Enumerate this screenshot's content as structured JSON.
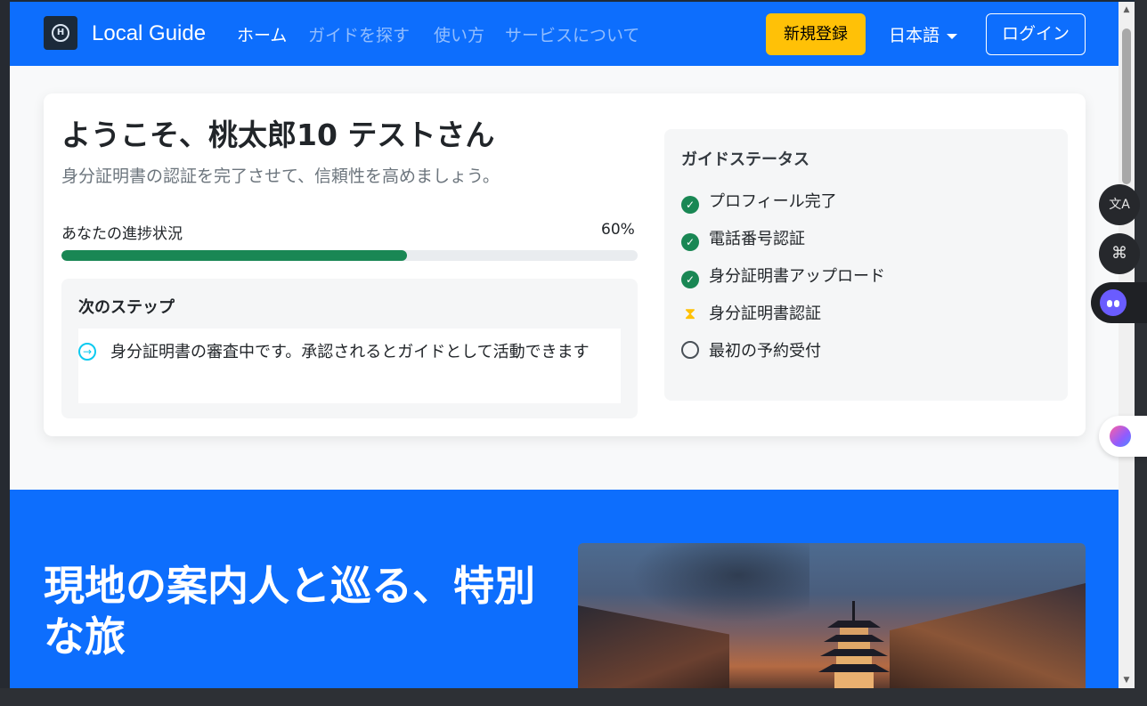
{
  "navbar": {
    "brand": "Local Guide",
    "links": [
      "ホーム",
      "ガイドを探す",
      "使い方",
      "サービスについて"
    ],
    "register_label": "新規登録",
    "language": "日本語",
    "login_label": "ログイン",
    "color": "#0d6efd"
  },
  "welcome": {
    "title": "ようこそ、桃太郎10 テストさん",
    "subtitle": "身分証明書の認証を完了させて、信頼性を高めましょう。",
    "progress_label": "あなたの進捗状況",
    "progress_value": 60,
    "progress_text": "60%",
    "next_title": "次のステップ",
    "next_text": "身分証明書の審査中です。承認されるとガイドとして活動できます"
  },
  "status": {
    "title": "ガイドステータス",
    "items": [
      {
        "label": "プロフィール完了",
        "state": "done"
      },
      {
        "label": "電話番号認証",
        "state": "done"
      },
      {
        "label": "身分証明書アップロード",
        "state": "done"
      },
      {
        "label": "身分証明書認証",
        "state": "pending"
      },
      {
        "label": "最初の予約受付",
        "state": "todo"
      }
    ]
  },
  "hero": {
    "title": "現地の案内人と巡る、特別な旅"
  },
  "side_tools": {
    "translate_glyph": "文A",
    "apps_glyph": "⌘"
  }
}
